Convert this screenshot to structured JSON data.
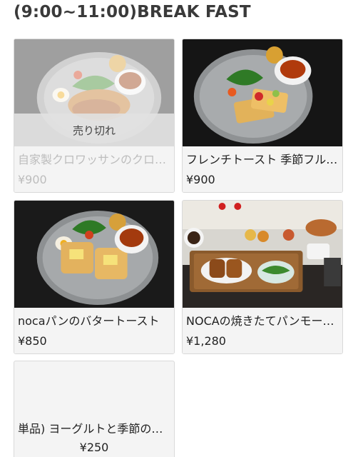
{
  "section": {
    "title": "(9:00~11:00)BREAK FAST"
  },
  "items": [
    {
      "name": "自家製クロワッサンのクロックムッシュ",
      "price": "¥900",
      "sold_out": true,
      "sold_out_label": "売り切れ"
    },
    {
      "name": "フレンチトースト 季節フルーツ添え",
      "price": "¥900",
      "sold_out": false
    },
    {
      "name": "nocaパンのバタートースト",
      "price": "¥850",
      "sold_out": false
    },
    {
      "name": "NOCAの焼きたてパンモーニング",
      "price": "¥1,280",
      "sold_out": false
    },
    {
      "name": "単品) ヨーグルトと季節のフルーツ",
      "price": "¥250",
      "sold_out": false
    }
  ],
  "colors": {
    "card_border": "#d9d9d9",
    "info_bg": "#f4f4f4",
    "soldout_text": "#bdbdbd"
  }
}
